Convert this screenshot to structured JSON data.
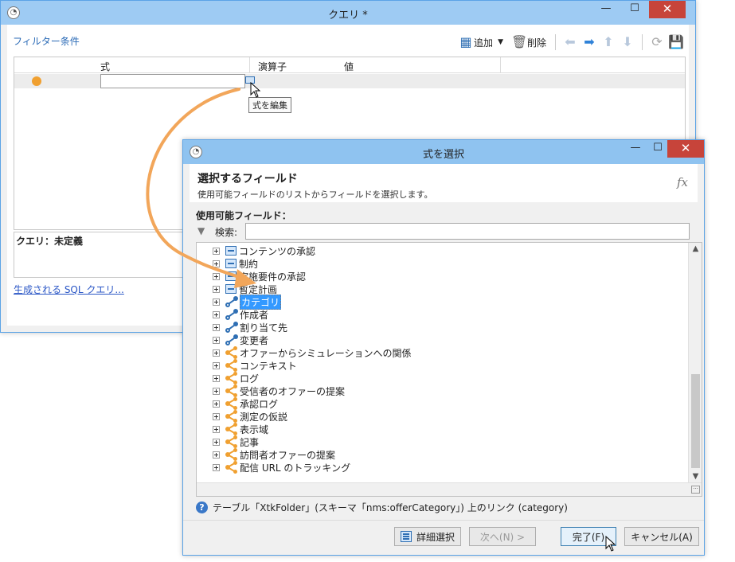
{
  "main_window": {
    "title": "クエリ *",
    "filter_tab": "フィルター条件",
    "toolbar": {
      "add_label": "追加",
      "delete_label": "削除"
    },
    "grid": {
      "col_expression": "式",
      "col_operator": "演算子",
      "col_value": "値"
    },
    "tooltip": "式を編集",
    "query_label": "クエリ：未定義",
    "sql_link": "生成される SQL クエリ..."
  },
  "dialog": {
    "title": "式を選択",
    "header_title": "選択するフィールド",
    "header_subtitle": "使用可能フィールドのリストからフィールドを選択します。",
    "fx_label": "fx",
    "available_fields_label": "使用可能フィールド：",
    "search_label": "検索:",
    "search_value": "",
    "tree_items": [
      {
        "label": "コンテンツの承認",
        "icon": "collection-icon"
      },
      {
        "label": "制約",
        "icon": "collection-icon"
      },
      {
        "label": "実施要件の承認",
        "icon": "collection-icon"
      },
      {
        "label": "暫定計画",
        "icon": "collection-icon"
      },
      {
        "label": "カテゴリ",
        "icon": "link-icon",
        "selected": true
      },
      {
        "label": "作成者",
        "icon": "link-icon"
      },
      {
        "label": "割り当て先",
        "icon": "link-icon"
      },
      {
        "label": "変更者",
        "icon": "link-icon"
      },
      {
        "label": "オファーからシミュレーションへの関係",
        "icon": "collection-link-icon"
      },
      {
        "label": "コンテキスト",
        "icon": "collection-link-icon"
      },
      {
        "label": "ログ",
        "icon": "collection-link-icon"
      },
      {
        "label": "受信者のオファーの提案",
        "icon": "collection-link-icon"
      },
      {
        "label": "承認ログ",
        "icon": "collection-link-icon"
      },
      {
        "label": "測定の仮説",
        "icon": "collection-link-icon"
      },
      {
        "label": "表示域",
        "icon": "collection-link-icon"
      },
      {
        "label": "記事",
        "icon": "collection-link-icon"
      },
      {
        "label": "訪問者オファーの提案",
        "icon": "collection-link-icon"
      },
      {
        "label": "配信 URL のトラッキング",
        "icon": "collection-link-icon"
      }
    ],
    "info_text": "テーブル「XtkFolder」(スキーマ「nms:offerCategory」) 上のリンク (category)",
    "buttons": {
      "advanced": "詳細選択",
      "next": "次へ(N) >",
      "finish": "完了(F)",
      "cancel": "キャンセル(A)"
    }
  },
  "colors": {
    "title_bar": "#9ecbf3",
    "accent": "#3399ff",
    "orange": "#f0a030",
    "close": "#c7443a"
  }
}
